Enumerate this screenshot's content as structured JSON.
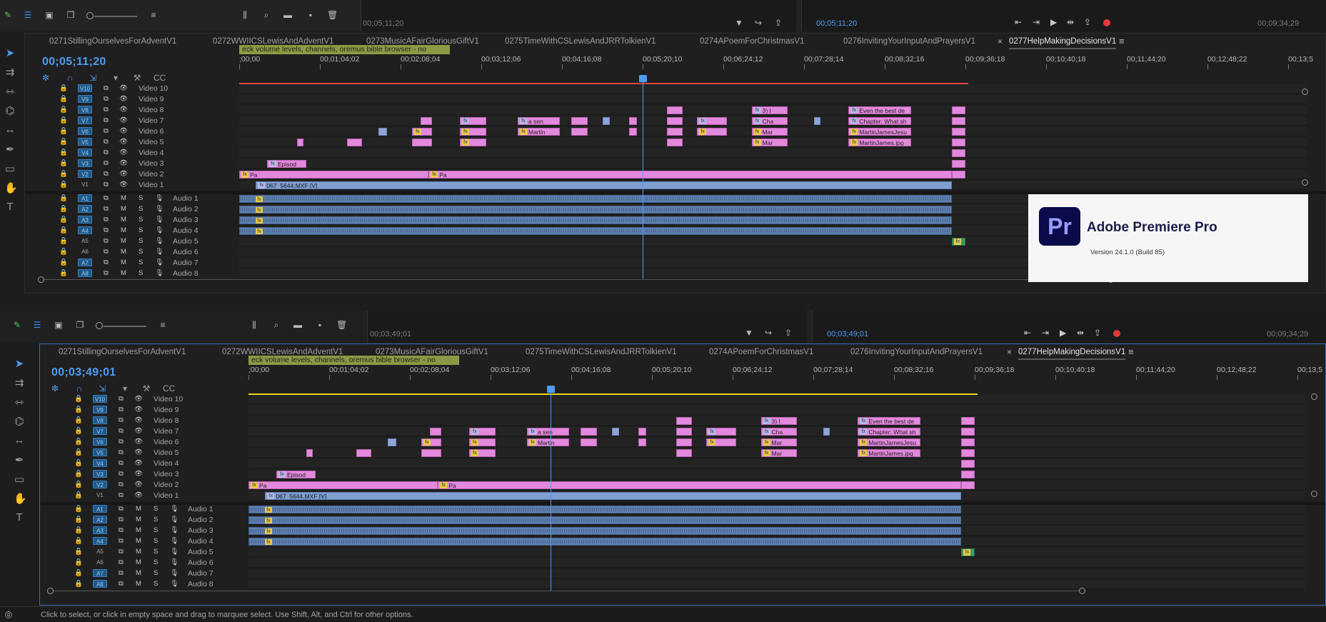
{
  "top_monitor": {
    "source_timecode": "00;05;11;20",
    "program_timecode": "00;05;11;20",
    "program_duration": "00;09;34;29"
  },
  "bottom_monitor": {
    "source_timecode": "00;03;49;01",
    "program_timecode": "00;03;49;01",
    "program_duration": "00;09;34;29"
  },
  "tabs": [
    {
      "label": "0271StillingOurselvesForAdventV1",
      "active": false
    },
    {
      "label": "0272WWIICSLewisAndAdventV1",
      "active": false
    },
    {
      "label": "0273MusicAFairGloriousGiftV1",
      "active": false
    },
    {
      "label": "0275TimeWithCSLewisAndJRRTolkienV1",
      "active": false
    },
    {
      "label": "0274APoemForChristmasV1",
      "active": false
    },
    {
      "label": "0276InvitingYourInputAndPrayersV1",
      "active": false
    },
    {
      "label": "0277HelpMakingDecisionsV1",
      "active": true
    }
  ],
  "top_timeline": {
    "timecode": "00;05;11;20",
    "sequence_label": "eck volume levels, channels, oremus bible browser - no",
    "ruler": ";00;00|00;01;04;02|00;02;08;04|00;03;12;06|00;04;16;08|00;05;20;10|00;06;24;12|00;07;28;14|00;08;32;16|00;09;36;18|00;10;40;18|00;11;44;20|00;12;48;22|00;13;5",
    "playhead_fraction": 0.362
  },
  "bottom_timeline": {
    "timecode": "00;03;49;01",
    "sequence_label": "eck volume levels, channels, oremus bible browser - no",
    "ruler": ";00;00|00;01;04;02|00;02;08;04|00;03;12;06|00;04;16;08|00;05;20;10|00;06;24;12|00;07;28;14|00;08;32;16|00;09;36;18|00;10;40;18|00;11;44;20|00;12;48;22|00;13;5",
    "playhead_fraction": 0.271
  },
  "video_tracks": [
    {
      "src": "V10",
      "name": "Video 10"
    },
    {
      "src": "V9",
      "name": "Video 9"
    },
    {
      "src": "V8",
      "name": "Video 8"
    },
    {
      "src": "V7",
      "name": "Video 7"
    },
    {
      "src": "V6",
      "name": "Video 6"
    },
    {
      "src": "V5",
      "name": "Video 5"
    },
    {
      "src": "V4",
      "name": "Video 4"
    },
    {
      "src": "V3",
      "name": "Video 3"
    },
    {
      "src": "V2",
      "name": "Video 2"
    },
    {
      "src": "V1",
      "name": "Video 1"
    }
  ],
  "audio_tracks": [
    {
      "src": "A1",
      "name": "Audio 1"
    },
    {
      "src": "A2",
      "name": "Audio 2"
    },
    {
      "src": "A3",
      "name": "Audio 3"
    },
    {
      "src": "A4",
      "name": "Audio 4"
    },
    {
      "src": "A5",
      "name": "Audio 5"
    },
    {
      "src": "A6",
      "name": "Audio 6"
    },
    {
      "src": "A7",
      "name": "Audio 7"
    },
    {
      "src": "A8",
      "name": "Audio 8"
    }
  ],
  "clip_labels": {
    "episode": "Episod",
    "pa": "Pa",
    "video1": "067_5644.MXF [V]",
    "a_sen": "a sen",
    "martin": "Martin",
    "three_i": "3) I",
    "cha": "Cha",
    "mar": "Mar",
    "even_best": "Even the best de",
    "chapter": "Chapter: What sh",
    "mj_jesu": "MartinJamesJesu",
    "mj_jpg": "MartinJames.jpg"
  },
  "splash": {
    "logo": "Pr",
    "title": "Adobe Premiere Pro",
    "version": "Version 24.1.0 (Build 85)"
  },
  "status": {
    "text": "Click to select, or click in empty space and drag to marquee select. Use Shift, Alt, and Ctrl for other options."
  },
  "track_ms_labels": {
    "m": "M",
    "s": "S"
  },
  "colors": {
    "accent": "#4f9cf3",
    "video_clip": "#e389dd",
    "audio_clip": "#5d7fae",
    "sequence_label": "#8a9a44",
    "work_area_top": "#e04545",
    "work_area_bottom": "#e6d820"
  }
}
